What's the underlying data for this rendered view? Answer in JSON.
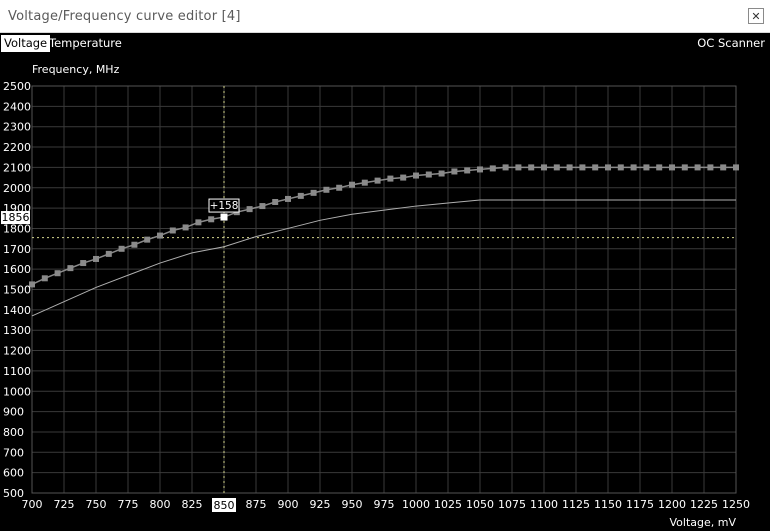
{
  "window": {
    "title": "Voltage/Frequency curve editor [4]",
    "close_glyph": "✕"
  },
  "tabs": [
    {
      "label": "Voltage",
      "active": true
    },
    {
      "label": "Temperature",
      "active": false
    }
  ],
  "oc_scanner_label": "OC Scanner",
  "colors": {
    "background": "#000000",
    "grid": "#3a3a3a",
    "axis_text": "#ffffff",
    "curve": "#8a8a8a",
    "baseline": "#b0b0b0",
    "selected_point": "#ffffff"
  },
  "chart_data": {
    "type": "line",
    "xlabel": "Voltage, mV",
    "ylabel": "Frequency, MHz",
    "xlim": [
      700,
      1250
    ],
    "ylim": [
      500,
      2500
    ],
    "x_ticks": [
      700,
      725,
      750,
      775,
      800,
      825,
      850,
      875,
      900,
      925,
      950,
      975,
      1000,
      1025,
      1050,
      1075,
      1100,
      1125,
      1150,
      1175,
      1200,
      1225,
      1250
    ],
    "y_ticks": [
      500,
      600,
      700,
      800,
      900,
      1000,
      1100,
      1200,
      1300,
      1400,
      1500,
      1600,
      1700,
      1800,
      1900,
      2000,
      2100,
      2200,
      2300,
      2400,
      2500
    ],
    "grid": true,
    "series": [
      {
        "role": "curve",
        "x": [
          700,
          710,
          720,
          730,
          740,
          750,
          760,
          770,
          780,
          790,
          800,
          810,
          820,
          830,
          840,
          850,
          860,
          870,
          880,
          890,
          900,
          910,
          920,
          930,
          940,
          950,
          960,
          970,
          980,
          990,
          1000,
          1010,
          1020,
          1030,
          1040,
          1050,
          1060,
          1070,
          1080,
          1090,
          1100,
          1110,
          1120,
          1130,
          1140,
          1150,
          1160,
          1170,
          1180,
          1190,
          1200,
          1210,
          1220,
          1230,
          1240,
          1250
        ],
        "y": [
          1525,
          1555,
          1580,
          1605,
          1630,
          1650,
          1675,
          1700,
          1720,
          1745,
          1765,
          1790,
          1805,
          1830,
          1845,
          1856,
          1880,
          1895,
          1910,
          1930,
          1945,
          1960,
          1975,
          1990,
          2000,
          2015,
          2025,
          2035,
          2045,
          2050,
          2060,
          2065,
          2070,
          2080,
          2085,
          2090,
          2095,
          2100,
          2100,
          2100,
          2100,
          2100,
          2100,
          2100,
          2100,
          2100,
          2100,
          2100,
          2100,
          2100,
          2100,
          2100,
          2100,
          2100,
          2100,
          2100
        ]
      },
      {
        "role": "baseline",
        "x": [
          700,
          725,
          750,
          775,
          800,
          825,
          850,
          875,
          900,
          925,
          950,
          975,
          1000,
          1025,
          1050,
          1075,
          1100,
          1150,
          1200,
          1250
        ],
        "y": [
          1370,
          1440,
          1510,
          1570,
          1630,
          1680,
          1710,
          1760,
          1800,
          1840,
          1870,
          1890,
          1910,
          1925,
          1940,
          1940,
          1940,
          1940,
          1940,
          1940
        ]
      }
    ],
    "selected_point": {
      "x": 850,
      "y": 1856,
      "offset_label": "+158",
      "freq_label": "1856",
      "volt_label": "850"
    },
    "reference_line_y": 1755
  }
}
